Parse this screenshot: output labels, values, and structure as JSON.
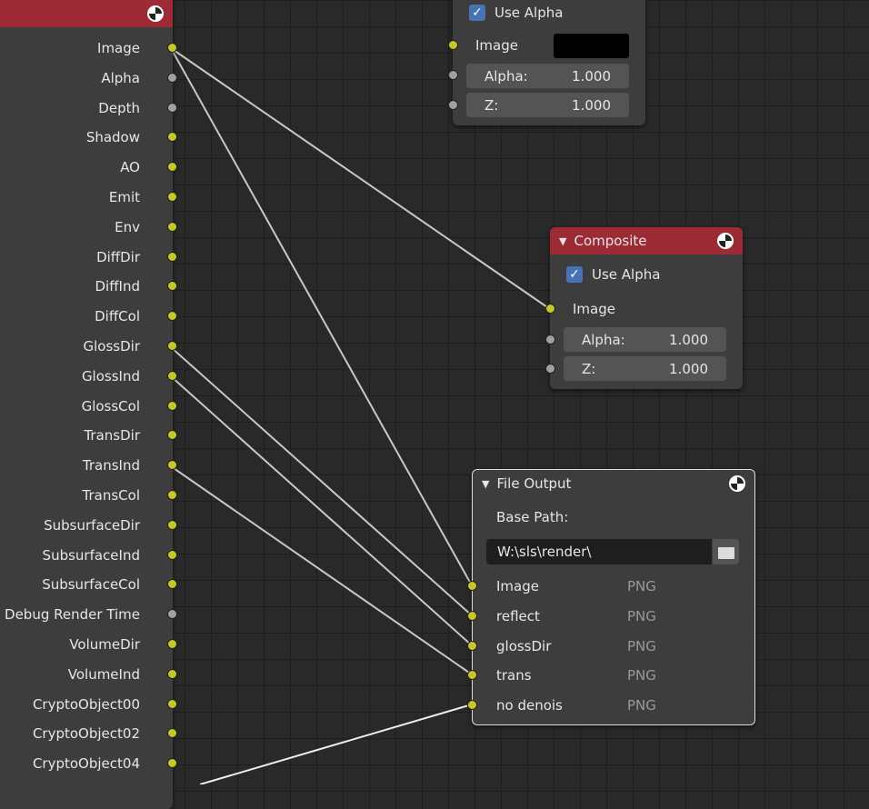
{
  "render_layers": {
    "outputs": [
      {
        "label": "Image",
        "type": "color"
      },
      {
        "label": "Alpha",
        "type": "value"
      },
      {
        "label": "Depth",
        "type": "value"
      },
      {
        "label": "Shadow",
        "type": "color"
      },
      {
        "label": "AO",
        "type": "color"
      },
      {
        "label": "Emit",
        "type": "color"
      },
      {
        "label": "Env",
        "type": "color"
      },
      {
        "label": "DiffDir",
        "type": "color"
      },
      {
        "label": "DiffInd",
        "type": "color"
      },
      {
        "label": "DiffCol",
        "type": "color"
      },
      {
        "label": "GlossDir",
        "type": "color"
      },
      {
        "label": "GlossInd",
        "type": "color"
      },
      {
        "label": "GlossCol",
        "type": "color"
      },
      {
        "label": "TransDir",
        "type": "color"
      },
      {
        "label": "TransInd",
        "type": "color"
      },
      {
        "label": "TransCol",
        "type": "color"
      },
      {
        "label": "SubsurfaceDir",
        "type": "color"
      },
      {
        "label": "SubsurfaceInd",
        "type": "color"
      },
      {
        "label": "SubsurfaceCol",
        "type": "color"
      },
      {
        "label": "Debug Render Time",
        "type": "value"
      },
      {
        "label": "VolumeDir",
        "type": "color"
      },
      {
        "label": "VolumeInd",
        "type": "color"
      },
      {
        "label": "CryptoObject00",
        "type": "color"
      },
      {
        "label": "CryptoObject02",
        "type": "color"
      },
      {
        "label": "CryptoObject04",
        "type": "color"
      }
    ]
  },
  "viewer": {
    "use_alpha": "Use Alpha",
    "image": "Image",
    "alpha_label": "Alpha:",
    "alpha": "1.000",
    "z_label": "Z:",
    "z": "1.000"
  },
  "composite": {
    "title": "Composite",
    "use_alpha": "Use Alpha",
    "image": "Image",
    "alpha_label": "Alpha:",
    "alpha": "1.000",
    "z_label": "Z:",
    "z": "1.000"
  },
  "file_output": {
    "title": "File Output",
    "base_path_label": "Base Path:",
    "base_path": "W:\\sls\\render\\",
    "inputs": [
      {
        "label": "Image",
        "format": "PNG"
      },
      {
        "label": "reflect",
        "format": "PNG"
      },
      {
        "label": "glossDir",
        "format": "PNG"
      },
      {
        "label": "trans",
        "format": "PNG"
      },
      {
        "label": "no denois",
        "format": "PNG"
      }
    ]
  },
  "colors": {
    "header_red": "#9c2b36",
    "socket_color": "#c7c729",
    "socket_value": "#a1a1a1",
    "checkbox": "#4772b3"
  }
}
